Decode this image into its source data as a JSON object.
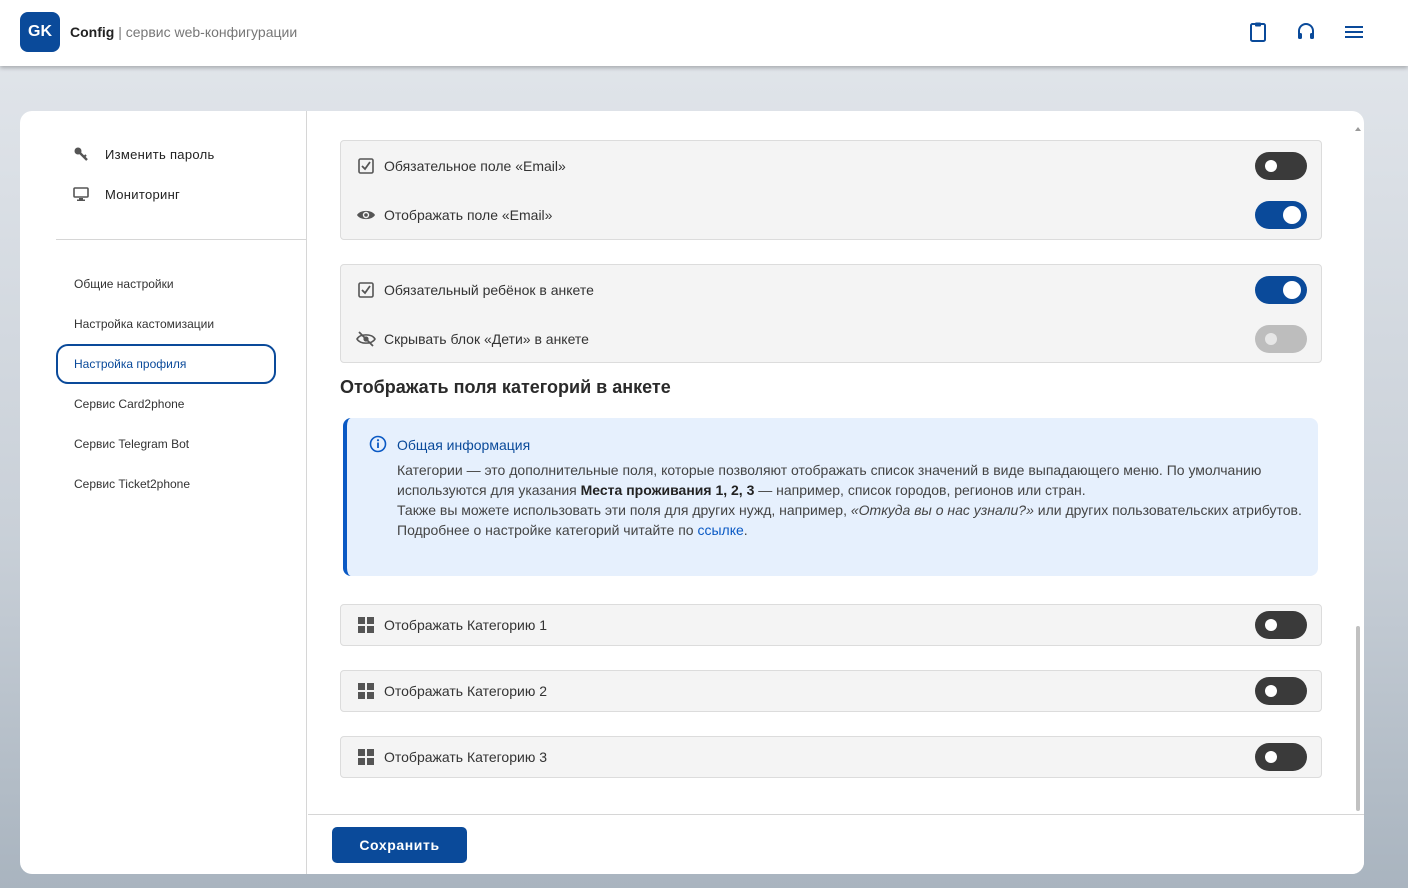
{
  "header": {
    "logo": "GK",
    "app_name": "Config",
    "separator": "|",
    "app_subtitle": "сервис web-конфигурации",
    "icons": [
      "clipboard-icon",
      "headset-icon",
      "menu-icon"
    ]
  },
  "sidebar": {
    "top_items": [
      {
        "label": "Изменить пароль",
        "icon": "key-icon"
      },
      {
        "label": "Мониторинг",
        "icon": "monitor-icon"
      }
    ],
    "nav_items": [
      {
        "label": "Общие настройки"
      },
      {
        "label": "Настройка кастомизации"
      },
      {
        "label": "Настройка профиля",
        "active": true
      },
      {
        "label": "Сервис Card2phone"
      },
      {
        "label": "Сервис Telegram Bot"
      },
      {
        "label": "Сервис Ticket2phone"
      }
    ]
  },
  "main": {
    "email_group": [
      {
        "label": "Обязательное поле «Email»",
        "icon": "checkbox-icon",
        "state": "off"
      },
      {
        "label": "Отображать поле «Email»",
        "icon": "eye-icon",
        "state": "on"
      }
    ],
    "child_group": [
      {
        "label": "Обязательный ребёнок в анкете",
        "icon": "checkbox-icon",
        "state": "on"
      },
      {
        "label": "Скрывать блок «Дети» в анкете",
        "icon": "eye-off-icon",
        "state": "disabled"
      }
    ],
    "section_title": "Отображать поля категорий в анкете",
    "info": {
      "title": "Общая информация",
      "line1_a": "Категории — это дополнительные поля, которые позволяют отображать список значений в виде выпадающего меню. По умолчанию используются для указания ",
      "line1_bold": "Места проживания 1, 2, 3",
      "line1_b": " — например, список городов, регионов или стран.",
      "line2_a": "Также вы можете использовать эти поля для других нужд, например, ",
      "line2_italic": "«Откуда вы о нас узнали?»",
      "line2_b": " или других пользовательских атрибутов.",
      "line3_a": "Подробнее о настройке категорий читайте по ",
      "line3_link": "ссылке",
      "line3_b": "."
    },
    "categories": [
      {
        "label": "Отображать Категорию 1",
        "icon": "grid-icon",
        "state": "off"
      },
      {
        "label": "Отображать Категорию 2",
        "icon": "grid-icon",
        "state": "off"
      },
      {
        "label": "Отображать Категорию 3",
        "icon": "grid-icon",
        "state": "off"
      }
    ]
  },
  "footer": {
    "save_label": "Сохранить"
  },
  "colors": {
    "brand": "#0a4a9a",
    "toggle_off": "#3a3a3a",
    "toggle_disabled": "#bdbdbd",
    "info_bg": "#e6f0fd"
  }
}
